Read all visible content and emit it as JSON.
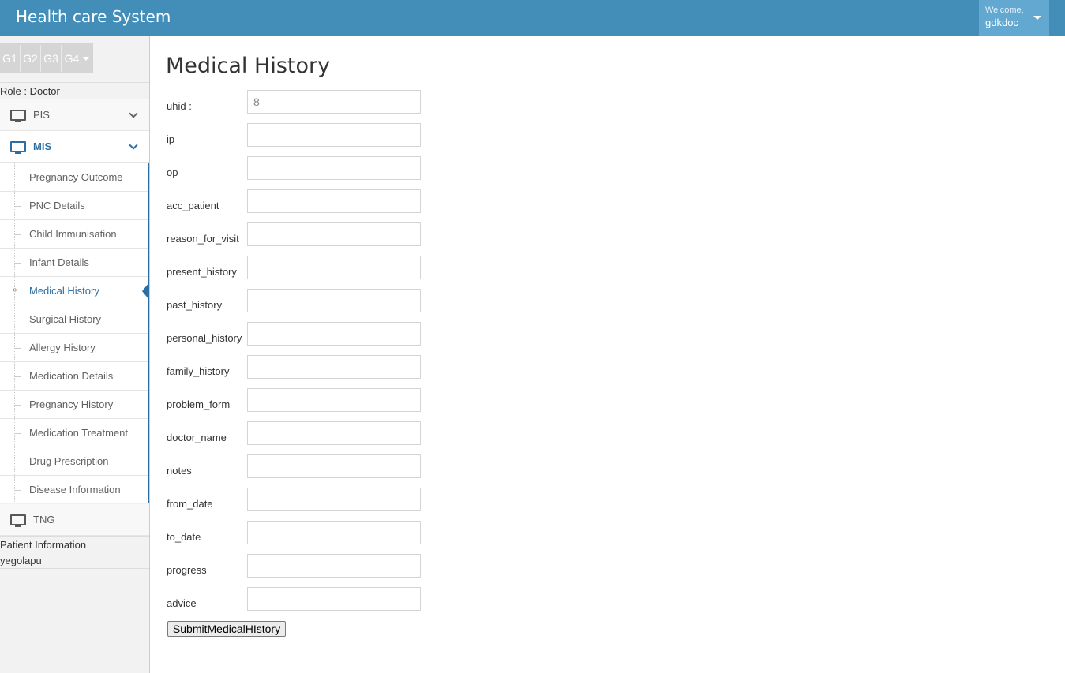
{
  "header": {
    "brand": "Health care System",
    "welcome_label": "Welcome,",
    "username": "gdkdoc",
    "bg_color": "#438eb9",
    "user_menu_color": "#62a8d1"
  },
  "sidebar": {
    "shortcuts": [
      "G1",
      "G2",
      "G3",
      "G4"
    ],
    "role": "Role : Doctor",
    "menu": {
      "pis": {
        "label": "PIS",
        "icon": "desktop-icon"
      },
      "mis": {
        "label": "MIS",
        "icon": "desktop-icon"
      },
      "tng": {
        "label": "TNG",
        "icon": "desktop-icon"
      }
    },
    "mis_items": [
      "Pregnancy Outcome",
      "PNC Details",
      "Child Immunisation",
      "Infant Details",
      "Medical History",
      "Surgical History",
      "Allergy History",
      "Medication Details",
      "Pregnancy History",
      "Medication Treatment",
      "Drug Prescription",
      "Disease Information"
    ],
    "active_item": "Medical History",
    "patient_info_label": "Patient Information",
    "patient_name": "yegolapu"
  },
  "main": {
    "title": "Medical History",
    "fields": [
      {
        "label": "uhid :",
        "value": "8"
      },
      {
        "label": "ip",
        "value": ""
      },
      {
        "label": "op",
        "value": ""
      },
      {
        "label": "acc_patient",
        "value": ""
      },
      {
        "label": "reason_for_visit",
        "value": ""
      },
      {
        "label": "present_history",
        "value": ""
      },
      {
        "label": "past_history",
        "value": ""
      },
      {
        "label": "personal_history",
        "value": ""
      },
      {
        "label": "family_history",
        "value": ""
      },
      {
        "label": "problem_form",
        "value": ""
      },
      {
        "label": "doctor_name",
        "value": ""
      },
      {
        "label": "notes",
        "value": ""
      },
      {
        "label": "from_date",
        "value": ""
      },
      {
        "label": "to_date",
        "value": ""
      },
      {
        "label": "progress",
        "value": ""
      },
      {
        "label": "advice",
        "value": ""
      }
    ],
    "submit_label": "SubmitMedicalHIstory"
  }
}
